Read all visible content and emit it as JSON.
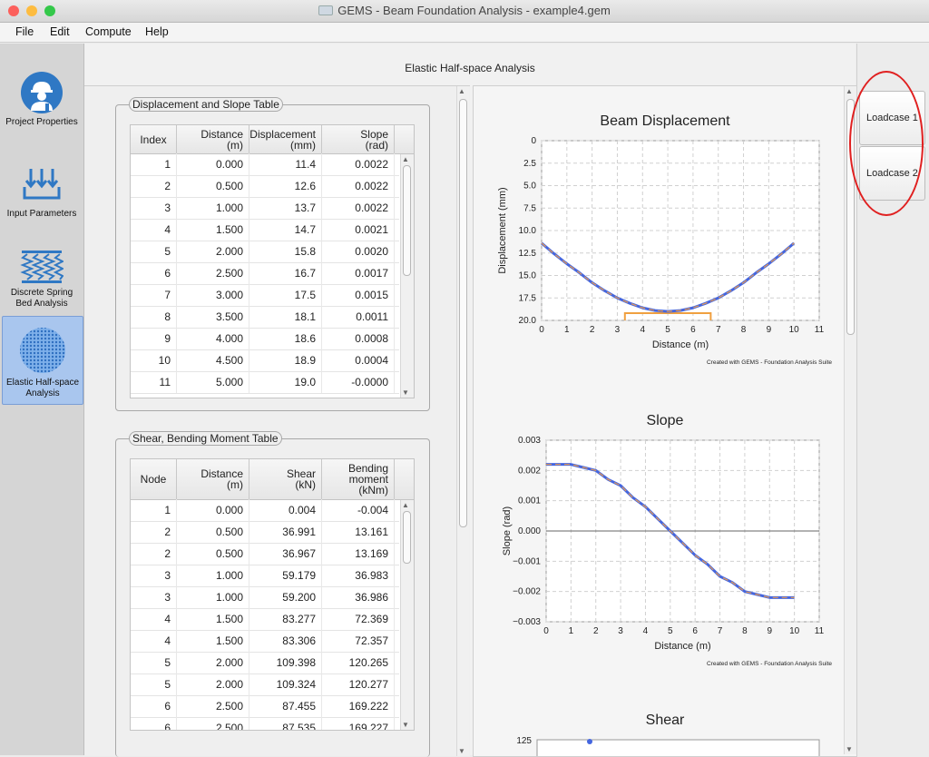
{
  "window": {
    "title": "GEMS - Beam Foundation Analysis - example4.gem",
    "traffic_lights": {
      "close": "#fc605c",
      "minimize": "#fdbc40",
      "maximize": "#34c84a"
    }
  },
  "menu": [
    "File",
    "Edit",
    "Compute",
    "Help"
  ],
  "sidebar": {
    "items": [
      {
        "label": "Project Properties",
        "icon": "engineer-icon",
        "active": false
      },
      {
        "label": "Input Parameters",
        "icon": "load-arrows-icon",
        "active": false
      },
      {
        "label": "Discrete Spring Bed Analysis",
        "line1": "Discrete Spring",
        "line2": "Bed Analysis",
        "icon": "springs-icon",
        "active": false
      },
      {
        "label": "Elastic Half-space Analysis",
        "line1": "Elastic Half-space",
        "line2": "Analysis",
        "icon": "halfspace-icon",
        "active": true
      }
    ]
  },
  "main": {
    "title": "Elastic Half-space Analysis"
  },
  "displacement_table": {
    "legend": "Displacement and Slope Table",
    "headers": [
      {
        "line1": "Index",
        "line2": ""
      },
      {
        "line1": "Distance",
        "line2": "(m)"
      },
      {
        "line1": "Displacement",
        "line2": "(mm)"
      },
      {
        "line1": "Slope",
        "line2": "(rad)"
      }
    ],
    "rows": [
      [
        "1",
        "0.000",
        "11.4",
        "0.0022"
      ],
      [
        "2",
        "0.500",
        "12.6",
        "0.0022"
      ],
      [
        "3",
        "1.000",
        "13.7",
        "0.0022"
      ],
      [
        "4",
        "1.500",
        "14.7",
        "0.0021"
      ],
      [
        "5",
        "2.000",
        "15.8",
        "0.0020"
      ],
      [
        "6",
        "2.500",
        "16.7",
        "0.0017"
      ],
      [
        "7",
        "3.000",
        "17.5",
        "0.0015"
      ],
      [
        "8",
        "3.500",
        "18.1",
        "0.0011"
      ],
      [
        "9",
        "4.000",
        "18.6",
        "0.0008"
      ],
      [
        "10",
        "4.500",
        "18.9",
        "0.0004"
      ],
      [
        "11",
        "5.000",
        "19.0",
        "-0.0000"
      ]
    ]
  },
  "shear_table": {
    "legend": "Shear, Bending Moment Table",
    "headers": [
      {
        "line1": "Node",
        "line2": "",
        "line3": ""
      },
      {
        "line1": "Distance",
        "line2": "(m)",
        "line3": ""
      },
      {
        "line1": "Shear",
        "line2": "(kN)",
        "line3": ""
      },
      {
        "line1": "Bending",
        "line2": "moment",
        "line3": "(kNm)"
      }
    ],
    "rows": [
      [
        "1",
        "0.000",
        "0.004",
        "-0.004"
      ],
      [
        "2",
        "0.500",
        "36.991",
        "13.161"
      ],
      [
        "2",
        "0.500",
        "36.967",
        "13.169"
      ],
      [
        "3",
        "1.000",
        "59.179",
        "36.983"
      ],
      [
        "3",
        "1.000",
        "59.200",
        "36.986"
      ],
      [
        "4",
        "1.500",
        "83.277",
        "72.369"
      ],
      [
        "4",
        "1.500",
        "83.306",
        "72.357"
      ],
      [
        "5",
        "2.000",
        "109.398",
        "120.265"
      ],
      [
        "5",
        "2.000",
        "109.324",
        "120.277"
      ],
      [
        "6",
        "2.500",
        "87.455",
        "169.222"
      ],
      [
        "6",
        "2.500",
        "87.535",
        "169.227"
      ]
    ]
  },
  "loadcases": [
    "Loadcase 1",
    "Loadcase 2"
  ],
  "annotation_color": "#e02020",
  "chart_colors": {
    "line": "#4466e0",
    "dash": "#e89a50",
    "bracket": "#f0a040"
  },
  "chart_data": [
    {
      "type": "line",
      "title": "Beam Displacement",
      "xlabel": "Distance  (m)",
      "ylabel": "Displacement  (mm)",
      "xlim": [
        0,
        11
      ],
      "ylim": [
        0,
        20
      ],
      "y_inverted": true,
      "grid": true,
      "xticks": [
        "0",
        "1",
        "2",
        "3",
        "4",
        "5",
        "6",
        "7",
        "8",
        "9",
        "10",
        "11"
      ],
      "yticks": [
        "0",
        "2.5",
        "5.0",
        "7.5",
        "10.0",
        "12.5",
        "15.0",
        "17.5",
        "20.0"
      ],
      "x": [
        0,
        0.5,
        1,
        1.5,
        2,
        2.5,
        3,
        3.5,
        4,
        4.5,
        5,
        5.5,
        6,
        6.5,
        7,
        7.5,
        8,
        8.5,
        9,
        9.5,
        10
      ],
      "y": [
        11.4,
        12.6,
        13.7,
        14.7,
        15.8,
        16.7,
        17.5,
        18.1,
        18.6,
        18.9,
        19.0,
        18.9,
        18.6,
        18.1,
        17.5,
        16.7,
        15.8,
        14.7,
        13.7,
        12.6,
        11.4
      ],
      "footing_bracket": {
        "x_start": 3.3,
        "x_end": 6.7
      },
      "credit": "Created with GEMS - Foundation Analysis Suite"
    },
    {
      "type": "line",
      "title": "Slope",
      "xlabel": "Distance  (m)",
      "ylabel": "Slope  (rad)",
      "xlim": [
        0,
        11
      ],
      "ylim": [
        -0.003,
        0.003
      ],
      "grid": true,
      "xticks": [
        "0",
        "1",
        "2",
        "3",
        "4",
        "5",
        "6",
        "7",
        "8",
        "9",
        "10",
        "11"
      ],
      "yticks": [
        "0.003",
        "0.002",
        "0.001",
        "0.000",
        "−0.001",
        "−0.002",
        "−0.003"
      ],
      "x": [
        0,
        0.5,
        1,
        1.5,
        2,
        2.5,
        3,
        3.5,
        4,
        4.5,
        5,
        5.5,
        6,
        6.5,
        7,
        7.5,
        8,
        8.5,
        9,
        9.5,
        10
      ],
      "y": [
        0.0022,
        0.0022,
        0.0022,
        0.0021,
        0.002,
        0.0017,
        0.0015,
        0.0011,
        0.0008,
        0.0004,
        0.0,
        -0.0004,
        -0.0008,
        -0.0011,
        -0.0015,
        -0.0017,
        -0.002,
        -0.0021,
        -0.0022,
        -0.0022,
        -0.0022
      ],
      "credit": "Created with GEMS - Foundation Analysis Suite"
    },
    {
      "type": "line",
      "title": "Shear",
      "yticks": [
        "125"
      ]
    }
  ]
}
